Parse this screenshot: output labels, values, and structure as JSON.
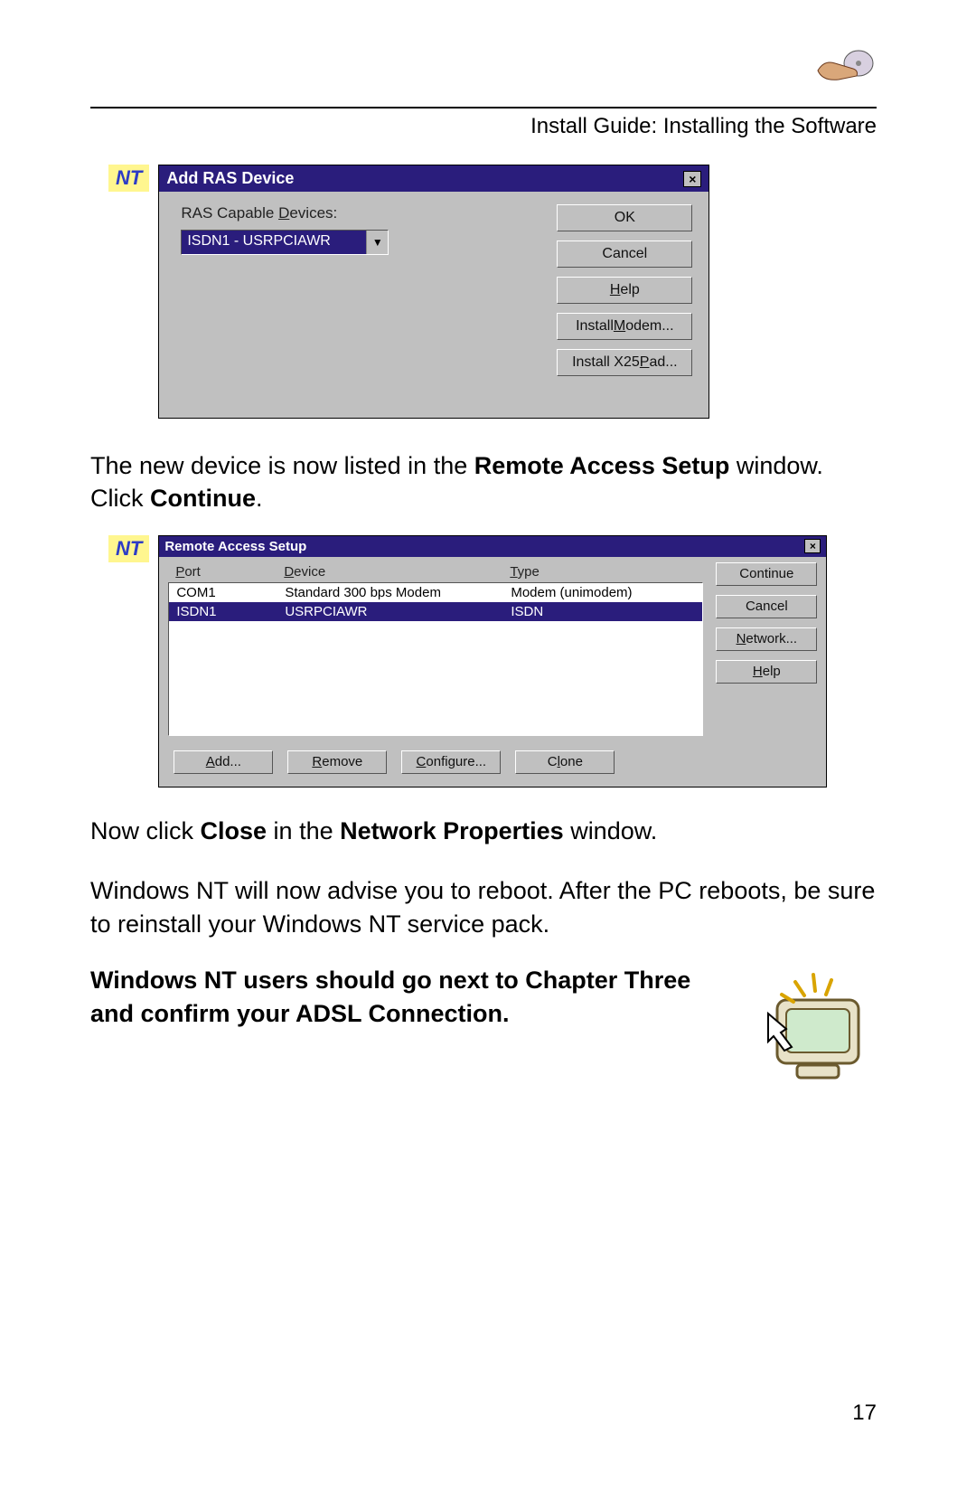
{
  "header": {
    "breadcrumb": "Install Guide: Installing the Software"
  },
  "nt_badge": "NT",
  "dialog1": {
    "title": "Add RAS Device",
    "field_label": "RAS Capable Devices:",
    "selected": "ISDN1 - USRPCIAWR",
    "buttons": {
      "ok": "OK",
      "cancel": "Cancel",
      "help": "Help",
      "install_modem": "Install Modem...",
      "install_x25": "Install X25 Pad..."
    }
  },
  "para1_a": "The new device is now listed in the ",
  "para1_b": "Remote Access Setup",
  "para1_c": " window. Click ",
  "para1_d": "Continue",
  "para1_e": ".",
  "dialog2": {
    "title": "Remote Access Setup",
    "columns": {
      "port": "Port",
      "device": "Device",
      "type": "Type"
    },
    "rows": [
      {
        "port": "COM1",
        "device": "Standard   300 bps Modem",
        "type": "Modem (unimodem)",
        "selected": false
      },
      {
        "port": "ISDN1",
        "device": "USRPCIAWR",
        "type": "ISDN",
        "selected": true
      }
    ],
    "side_buttons": {
      "continue": "Continue",
      "cancel": "Cancel",
      "network": "Network...",
      "help": "Help"
    },
    "bottom_buttons": {
      "add": "Add...",
      "remove": "Remove",
      "configure": "Configure...",
      "clone": "Clone"
    }
  },
  "para2_a": "Now click ",
  "para2_b": "Close",
  "para2_c": " in the ",
  "para2_d": "Network Properties",
  "para2_e": " window.",
  "para3": "Windows NT will now advise you to reboot.  After the PC reboots, be sure to reinstall your Windows NT service pack.",
  "note": "Windows NT users should go next to Chapter Three and confirm your ADSL Connection.",
  "page_number": "17"
}
